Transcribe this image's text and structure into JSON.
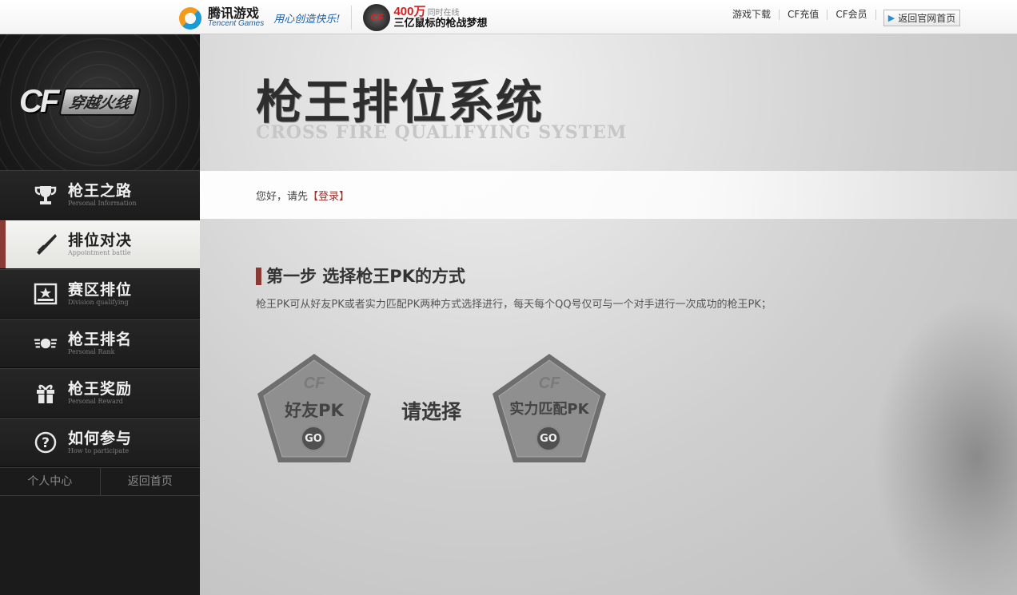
{
  "topbar": {
    "tencent_cn": "腾讯游戏",
    "tencent_en": "Tencent Games",
    "slogan": "用心创造快乐!",
    "cf_badge": "CF",
    "ad_count": "400万",
    "ad_online": "同时在线",
    "ad_line2": "三亿鼠标的枪战梦想",
    "links": [
      "游戏下载",
      "CF充值",
      "CF会员"
    ],
    "home_label": "返回官网首页"
  },
  "sidebar": {
    "logo_cf": "CF",
    "logo_name": "穿越火线",
    "items": [
      {
        "cn": "枪王之路",
        "en": "Personal Information",
        "icon": "trophy-icon"
      },
      {
        "cn": "排位对决",
        "en": "Appointment battle",
        "icon": "knife-icon",
        "active": true
      },
      {
        "cn": "赛区排位",
        "en": "Division qualifying",
        "icon": "division-icon"
      },
      {
        "cn": "枪王排名",
        "en": "Personal Rank",
        "icon": "rank-wings-icon"
      },
      {
        "cn": "枪王奖励",
        "en": "Personal Reward",
        "icon": "gift-icon"
      },
      {
        "cn": "如何参与",
        "en": "How to participate",
        "icon": "question-icon"
      }
    ],
    "sub_links": [
      "个人中心",
      "返回首页"
    ]
  },
  "main": {
    "title_cn": "枪王排位系统",
    "title_en": "CROSS FIRE QUALIFYING SYSTEM",
    "greeting": "您好，请先",
    "login": "【登录】",
    "step_title": "第一步 选择枪王PK的方式",
    "step_desc": "枪王PK可从好友PK或者实力匹配PK两种方式选择进行，每天每个QQ号仅可与一个对手进行一次成功的枪王PK；",
    "option1": "好友PK",
    "option2": "实力匹配PK",
    "go": "GO",
    "choose": "请选择"
  }
}
